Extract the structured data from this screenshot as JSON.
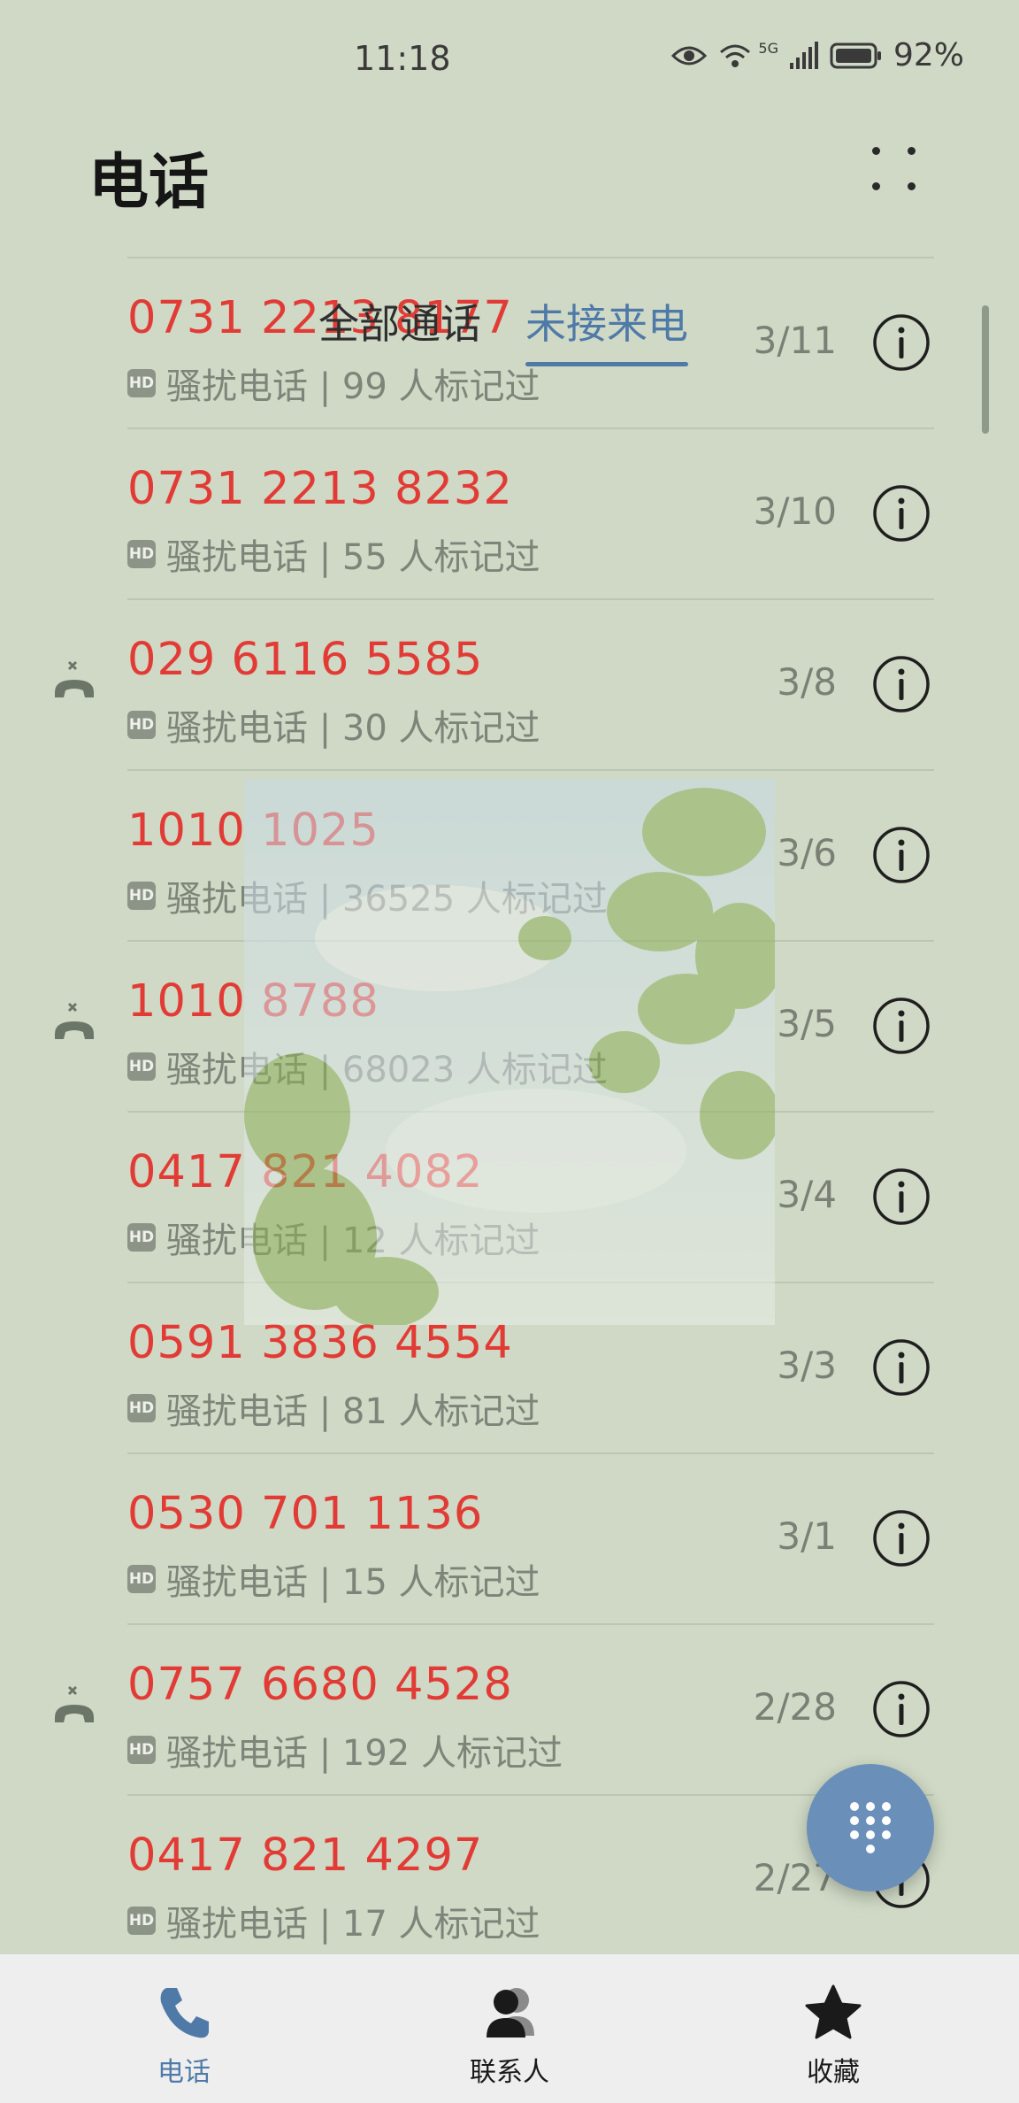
{
  "status_bar": {
    "time": "11:18",
    "network": "5G",
    "battery": "92%"
  },
  "header": {
    "title": "电话",
    "more_icon": "more-dots-icon"
  },
  "tabs": [
    {
      "label": "全部通话",
      "selected": false
    },
    {
      "label": "未接来电",
      "selected": true
    }
  ],
  "calls": [
    {
      "number": "0731 2213 8177",
      "badge": "HD",
      "desc": "骚扰电话 | 99 人标记过",
      "date": "3/11",
      "missed_icon": false
    },
    {
      "number": "0731 2213 8232",
      "badge": "HD",
      "desc": "骚扰电话 | 55 人标记过",
      "date": "3/10",
      "missed_icon": false
    },
    {
      "number": "029 6116 5585",
      "badge": "HD",
      "desc": "骚扰电话 | 30 人标记过",
      "date": "3/8",
      "missed_icon": true
    },
    {
      "number": "1010 1025",
      "badge": "HD",
      "desc": "骚扰电话 | 36525 人标记过",
      "date": "3/6",
      "missed_icon": false
    },
    {
      "number": "1010 8788",
      "badge": "HD",
      "desc": "骚扰电话 | 68023 人标记过",
      "date": "3/5",
      "missed_icon": true
    },
    {
      "number": "0417 821 4082",
      "badge": "HD",
      "desc": "骚扰电话 | 12 人标记过",
      "date": "3/4",
      "missed_icon": false
    },
    {
      "number": "0591 3836 4554",
      "badge": "HD",
      "desc": "骚扰电话 | 81 人标记过",
      "date": "3/3",
      "missed_icon": false
    },
    {
      "number": "0530 701 1136",
      "badge": "HD",
      "desc": "骚扰电话 | 15 人标记过",
      "date": "3/1",
      "missed_icon": false
    },
    {
      "number": "0757 6680 4528",
      "badge": "HD",
      "desc": "骚扰电话 | 192 人标记过",
      "date": "2/28",
      "missed_icon": true
    },
    {
      "number": "0417 821 4297",
      "badge": "HD",
      "desc": "骚扰电话 | 17 人标记过",
      "date": "2/27",
      "missed_icon": false
    }
  ],
  "bottom_nav": [
    {
      "label": "电话",
      "icon": "phone-icon",
      "active": true
    },
    {
      "label": "联系人",
      "icon": "contacts-icon",
      "active": false
    },
    {
      "label": "收藏",
      "icon": "star-icon",
      "active": false
    }
  ],
  "colors": {
    "background": "#cfd9c5",
    "accent": "#4f7aa8",
    "missed_number": "#e23b36",
    "fab": "#6a8fb9"
  }
}
